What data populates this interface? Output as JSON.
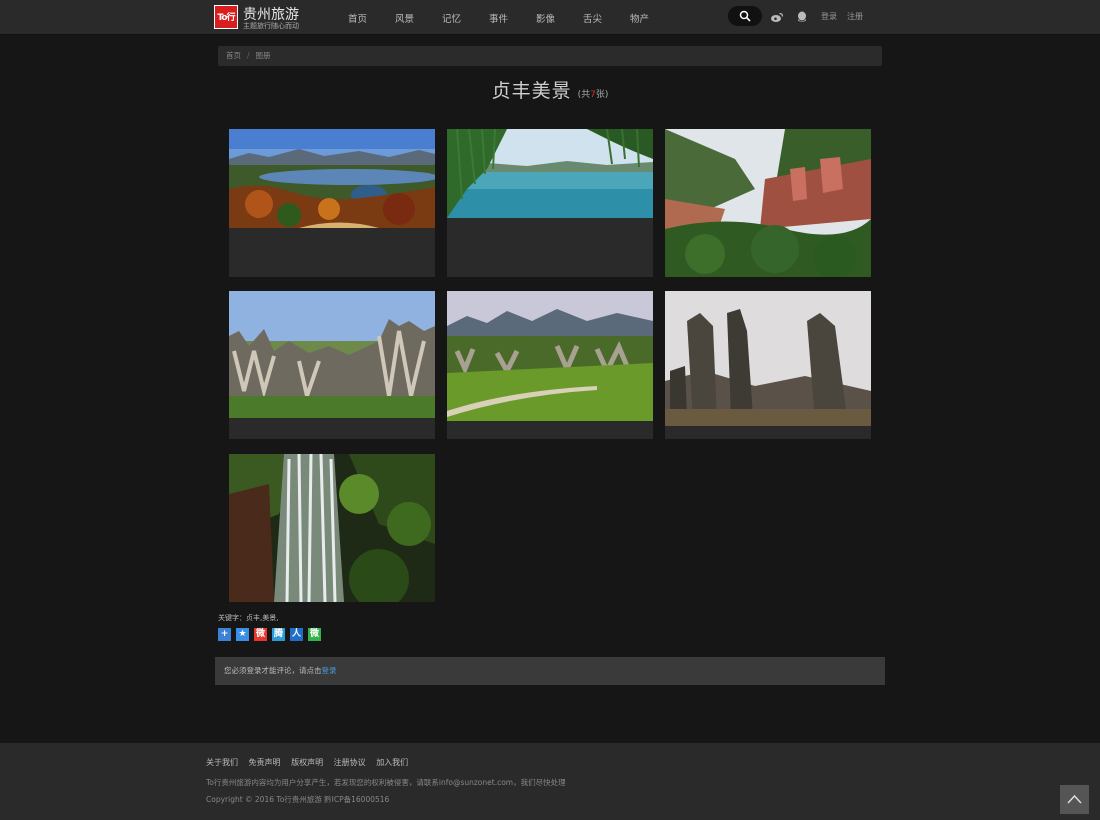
{
  "logo": {
    "badge": "To行",
    "title": "贵州旅游",
    "subtitle": "主题旅行随心而动"
  },
  "nav": [
    "首页",
    "风景",
    "记忆",
    "事件",
    "影像",
    "舌尖",
    "物产"
  ],
  "header": {
    "login": "登录",
    "register": "注册"
  },
  "breadcrumb": {
    "home": "首页",
    "sep": "/",
    "current": "图册"
  },
  "album": {
    "title": "贞丰美景",
    "count_prefix": "(共",
    "count": "7",
    "count_suffix": "张)"
  },
  "photos": [
    {
      "alt": "lake-valley-autumn"
    },
    {
      "alt": "lake-willow"
    },
    {
      "alt": "red-cliff-forest"
    },
    {
      "alt": "karst-rock-ridge"
    },
    {
      "alt": "karst-valley-road"
    },
    {
      "alt": "stone-pillars"
    },
    {
      "alt": "waterfall"
    }
  ],
  "keywords": "关键字：贞丰,美景,",
  "share": [
    {
      "icon": "share-plus-icon",
      "glyph": "+",
      "color": "#3b82d6"
    },
    {
      "icon": "qzone-icon",
      "glyph": "★",
      "color": "#3a8ee6"
    },
    {
      "icon": "weibo-icon",
      "glyph": "微",
      "color": "#e6362f"
    },
    {
      "icon": "tencent-weibo-icon",
      "glyph": "腾",
      "color": "#2a9bd6"
    },
    {
      "icon": "renren-icon",
      "glyph": "人",
      "color": "#1f6fc6"
    },
    {
      "icon": "wechat-icon",
      "glyph": "微",
      "color": "#35b24a"
    }
  ],
  "comment": {
    "text": "您必须登录才能评论，请点击",
    "link": "登录"
  },
  "footer": {
    "links": [
      "关于我们",
      "免责声明",
      "版权声明",
      "注册协议",
      "加入我们"
    ],
    "note": "To行贵州旅游内容均为用户分享产生，若发现您的权利被侵害，请联系info@sunzonet.com，我们尽快处理",
    "copyright": "Copyright © 2016 To行贵州旅游 黔ICP备16000516"
  },
  "colors": {
    "accent": "#d81e1e",
    "link": "#4a9be0",
    "background": "#161616",
    "bar": "#2a2a2a"
  }
}
